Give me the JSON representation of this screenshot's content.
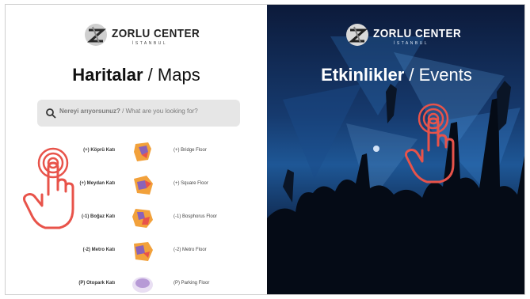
{
  "brand": {
    "name": "ZORLU CENTER",
    "city": "İSTANBUL"
  },
  "maps_panel": {
    "title_tr": "Haritalar",
    "title_sep": " / ",
    "title_en": "Maps",
    "search": {
      "placeholder_tr": "Nereyi arıyorsunuz?",
      "placeholder_sep": " / ",
      "placeholder_en": "What are you looking for?"
    },
    "floors": [
      {
        "tr": "(+) Köprü Katı",
        "en": "(+) Bridge Floor"
      },
      {
        "tr": "(+) Meydan Katı",
        "en": "(+) Square Floor"
      },
      {
        "tr": "(-1) Boğaz Katı",
        "en": "(-1) Bosphorus Floor"
      },
      {
        "tr": "(-2) Metro Katı",
        "en": "(-2) Metro Floor"
      },
      {
        "tr": "(P) Otopark Katı",
        "en": "(P) Parking Floor"
      }
    ]
  },
  "events_panel": {
    "title_tr": "Etkinlikler",
    "title_sep": " / ",
    "title_en": "Events"
  },
  "colors": {
    "accent_red": "#e8534a",
    "map_orange": "#f2a13b",
    "map_purple": "#8a62b8",
    "events_blue": "#1e5796"
  },
  "icons": {
    "search": "search-icon",
    "tap_hand": "tap-hand-icon",
    "logo": "zorlu-logo-icon"
  }
}
